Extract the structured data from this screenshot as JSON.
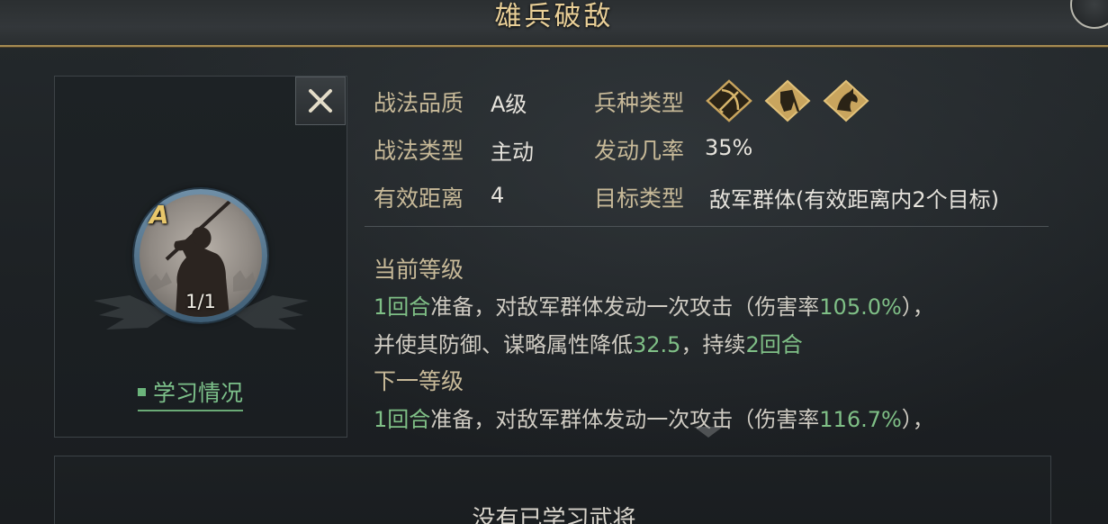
{
  "header": {
    "title": "雄兵破敌"
  },
  "skill": {
    "grade_badge": "A",
    "usage_count": "1/1",
    "learn_link_label": "学习情况"
  },
  "info": {
    "quality_label": "战法品质",
    "quality_value": "A级",
    "type_label": "战法类型",
    "type_value": "主动",
    "range_label": "有效距离",
    "range_value": "4",
    "troop_label": "兵种类型",
    "troop_icons": [
      "archer-troop-icon",
      "shield-troop-icon",
      "cavalry-troop-icon"
    ],
    "rate_label": "发动几率",
    "rate_value": "35%",
    "target_label": "目标类型",
    "target_value": "敌军群体(有效距离内2个目标)"
  },
  "current_level": {
    "title": "当前等级",
    "line1": {
      "turns": "1回合",
      "text": "准备，对敌军群体发动一次攻击（伤害率",
      "damage": "105.0%",
      "tail": "），"
    },
    "line2": {
      "text": "并使其防御、谋略属性降低",
      "reduce": "32.5",
      "mid": "，持续",
      "duration": "2回合"
    }
  },
  "next_level": {
    "title": "下一等级",
    "line1": {
      "turns": "1回合",
      "text": "准备，对敌军群体发动一次攻击（伤害率",
      "damage": "116.7%",
      "tail": "），"
    }
  },
  "generals_panel": {
    "empty_text": "没有已学习武将"
  },
  "colors": {
    "gold": "#e9cf97",
    "label": "#c7b998",
    "highlight": "#7fbf86",
    "text": "#cfcbc2"
  }
}
